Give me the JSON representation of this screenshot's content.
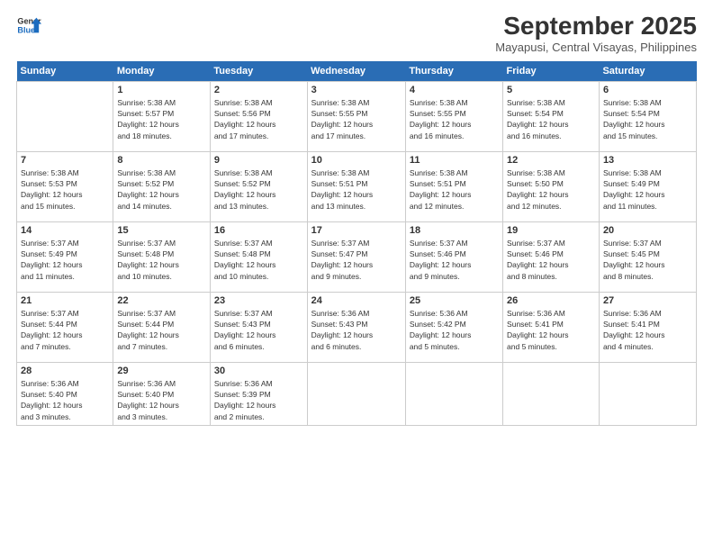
{
  "header": {
    "title": "September 2025",
    "subtitle": "Mayapusi, Central Visayas, Philippines"
  },
  "days": [
    "Sunday",
    "Monday",
    "Tuesday",
    "Wednesday",
    "Thursday",
    "Friday",
    "Saturday"
  ],
  "weeks": [
    [
      {
        "num": "",
        "detail": ""
      },
      {
        "num": "1",
        "detail": "Sunrise: 5:38 AM\nSunset: 5:57 PM\nDaylight: 12 hours\nand 18 minutes."
      },
      {
        "num": "2",
        "detail": "Sunrise: 5:38 AM\nSunset: 5:56 PM\nDaylight: 12 hours\nand 17 minutes."
      },
      {
        "num": "3",
        "detail": "Sunrise: 5:38 AM\nSunset: 5:55 PM\nDaylight: 12 hours\nand 17 minutes."
      },
      {
        "num": "4",
        "detail": "Sunrise: 5:38 AM\nSunset: 5:55 PM\nDaylight: 12 hours\nand 16 minutes."
      },
      {
        "num": "5",
        "detail": "Sunrise: 5:38 AM\nSunset: 5:54 PM\nDaylight: 12 hours\nand 16 minutes."
      },
      {
        "num": "6",
        "detail": "Sunrise: 5:38 AM\nSunset: 5:54 PM\nDaylight: 12 hours\nand 15 minutes."
      }
    ],
    [
      {
        "num": "7",
        "detail": "Sunrise: 5:38 AM\nSunset: 5:53 PM\nDaylight: 12 hours\nand 15 minutes."
      },
      {
        "num": "8",
        "detail": "Sunrise: 5:38 AM\nSunset: 5:52 PM\nDaylight: 12 hours\nand 14 minutes."
      },
      {
        "num": "9",
        "detail": "Sunrise: 5:38 AM\nSunset: 5:52 PM\nDaylight: 12 hours\nand 13 minutes."
      },
      {
        "num": "10",
        "detail": "Sunrise: 5:38 AM\nSunset: 5:51 PM\nDaylight: 12 hours\nand 13 minutes."
      },
      {
        "num": "11",
        "detail": "Sunrise: 5:38 AM\nSunset: 5:51 PM\nDaylight: 12 hours\nand 12 minutes."
      },
      {
        "num": "12",
        "detail": "Sunrise: 5:38 AM\nSunset: 5:50 PM\nDaylight: 12 hours\nand 12 minutes."
      },
      {
        "num": "13",
        "detail": "Sunrise: 5:38 AM\nSunset: 5:49 PM\nDaylight: 12 hours\nand 11 minutes."
      }
    ],
    [
      {
        "num": "14",
        "detail": "Sunrise: 5:37 AM\nSunset: 5:49 PM\nDaylight: 12 hours\nand 11 minutes."
      },
      {
        "num": "15",
        "detail": "Sunrise: 5:37 AM\nSunset: 5:48 PM\nDaylight: 12 hours\nand 10 minutes."
      },
      {
        "num": "16",
        "detail": "Sunrise: 5:37 AM\nSunset: 5:48 PM\nDaylight: 12 hours\nand 10 minutes."
      },
      {
        "num": "17",
        "detail": "Sunrise: 5:37 AM\nSunset: 5:47 PM\nDaylight: 12 hours\nand 9 minutes."
      },
      {
        "num": "18",
        "detail": "Sunrise: 5:37 AM\nSunset: 5:46 PM\nDaylight: 12 hours\nand 9 minutes."
      },
      {
        "num": "19",
        "detail": "Sunrise: 5:37 AM\nSunset: 5:46 PM\nDaylight: 12 hours\nand 8 minutes."
      },
      {
        "num": "20",
        "detail": "Sunrise: 5:37 AM\nSunset: 5:45 PM\nDaylight: 12 hours\nand 8 minutes."
      }
    ],
    [
      {
        "num": "21",
        "detail": "Sunrise: 5:37 AM\nSunset: 5:44 PM\nDaylight: 12 hours\nand 7 minutes."
      },
      {
        "num": "22",
        "detail": "Sunrise: 5:37 AM\nSunset: 5:44 PM\nDaylight: 12 hours\nand 7 minutes."
      },
      {
        "num": "23",
        "detail": "Sunrise: 5:37 AM\nSunset: 5:43 PM\nDaylight: 12 hours\nand 6 minutes."
      },
      {
        "num": "24",
        "detail": "Sunrise: 5:36 AM\nSunset: 5:43 PM\nDaylight: 12 hours\nand 6 minutes."
      },
      {
        "num": "25",
        "detail": "Sunrise: 5:36 AM\nSunset: 5:42 PM\nDaylight: 12 hours\nand 5 minutes."
      },
      {
        "num": "26",
        "detail": "Sunrise: 5:36 AM\nSunset: 5:41 PM\nDaylight: 12 hours\nand 5 minutes."
      },
      {
        "num": "27",
        "detail": "Sunrise: 5:36 AM\nSunset: 5:41 PM\nDaylight: 12 hours\nand 4 minutes."
      }
    ],
    [
      {
        "num": "28",
        "detail": "Sunrise: 5:36 AM\nSunset: 5:40 PM\nDaylight: 12 hours\nand 3 minutes."
      },
      {
        "num": "29",
        "detail": "Sunrise: 5:36 AM\nSunset: 5:40 PM\nDaylight: 12 hours\nand 3 minutes."
      },
      {
        "num": "30",
        "detail": "Sunrise: 5:36 AM\nSunset: 5:39 PM\nDaylight: 12 hours\nand 2 minutes."
      },
      {
        "num": "",
        "detail": ""
      },
      {
        "num": "",
        "detail": ""
      },
      {
        "num": "",
        "detail": ""
      },
      {
        "num": "",
        "detail": ""
      }
    ]
  ]
}
